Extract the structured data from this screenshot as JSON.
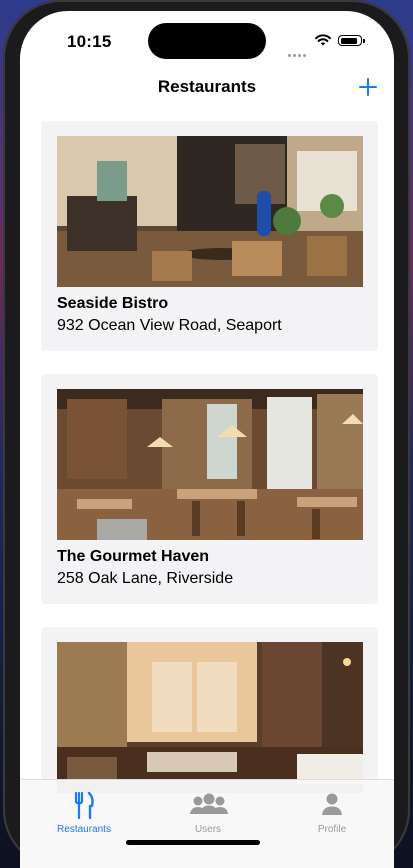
{
  "status_bar": {
    "time": "10:15"
  },
  "nav": {
    "title": "Restaurants",
    "add_icon": "plus-icon"
  },
  "restaurants": [
    {
      "name": "Seaside Bistro",
      "address": "932 Ocean View Road, Seaport"
    },
    {
      "name": "The Gourmet Haven",
      "address": "258 Oak Lane, Riverside"
    },
    {
      "name": "",
      "address": ""
    }
  ],
  "tabs": [
    {
      "label": "Restaurants",
      "icon": "fork-knife-icon",
      "active": true
    },
    {
      "label": "Users",
      "icon": "people-icon",
      "active": false
    },
    {
      "label": "Profile",
      "icon": "person-icon",
      "active": false
    }
  ],
  "colors": {
    "accent": "#1a7bf5",
    "inactive": "#9a9a9a",
    "card_bg": "#f3f3f5"
  }
}
